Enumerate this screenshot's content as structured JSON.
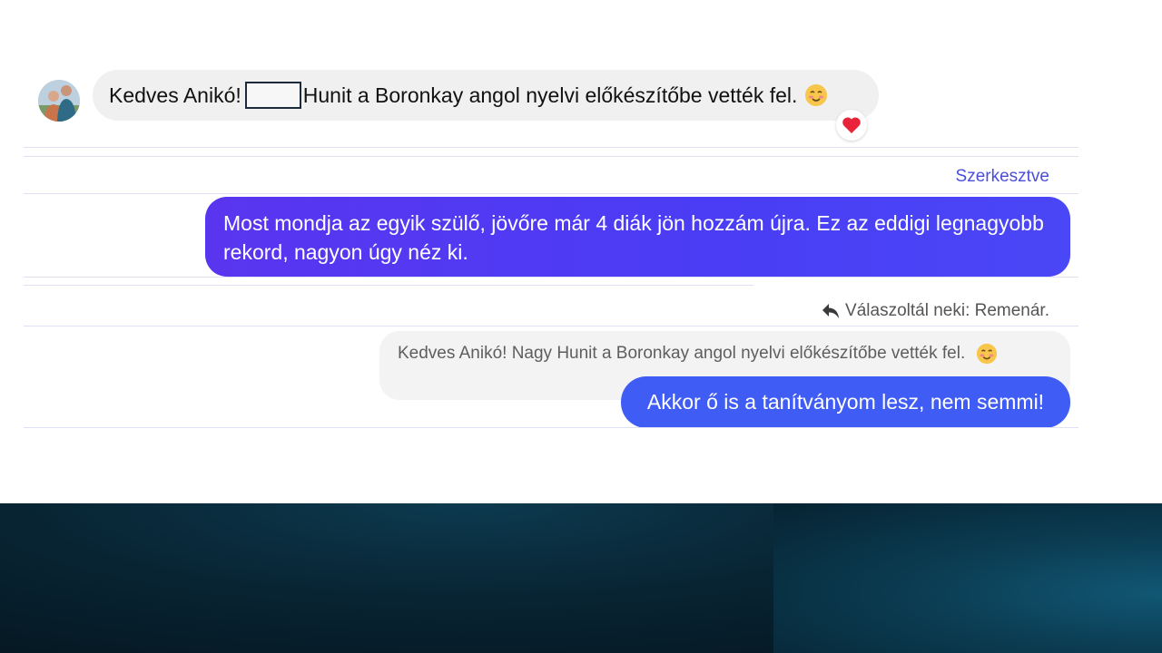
{
  "incoming_message": {
    "text_before": "Kedves Anikó!",
    "text_after": "Hunit a Boronkay angol nyelvi előkészítőbe vették fel.",
    "emoji": "blushing-face-emoji",
    "reaction": "heart-icon"
  },
  "edited_message": {
    "edited_label": "Szerkesztve",
    "text": "Most mondja az egyik szülő, jövőre már 4 diák jön hozzám újra. Ez az eddigi legnagyobb rekord, nagyon úgy néz ki."
  },
  "reply": {
    "indicator_text": "Válaszoltál neki: Remenár.",
    "quoted_text": "Kedves Anikó! Nagy Hunit a Boronkay angol nyelvi előkészítőbe vették fel.",
    "text": "Akkor ő is a tanítványom lesz, nem semmi!"
  },
  "colors": {
    "outgoing_bubble": "#4a3df5",
    "outgoing_bubble_2": "#3f5cf4",
    "incoming_bubble": "#f0f0f0",
    "edited_label": "#4b4fd8"
  }
}
